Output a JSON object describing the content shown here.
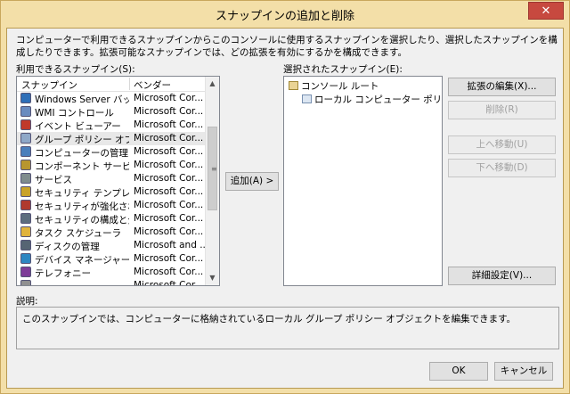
{
  "window": {
    "title": "スナップインの追加と削除",
    "close_glyph": "✕"
  },
  "intro_text": "コンピューターで利用できるスナップインからこのコンソールに使用するスナップインを選択したり、選択したスナップインを構成したりできます。拡張可能なスナップインでは、どの拡張を有効にするかを構成できます。",
  "available": {
    "label": "利用できるスナップイン(S):",
    "col_snapin": "スナップイン",
    "col_vendor": "ベンダー",
    "rows": [
      {
        "name": "Windows Server バッ...",
        "vendor": "Microsoft Cor...",
        "icon": "server-backup-icon",
        "color": "#2f6fb8"
      },
      {
        "name": "WMI コントロール",
        "vendor": "Microsoft Cor...",
        "icon": "wmi-icon",
        "color": "#6a8bbf"
      },
      {
        "name": "イベント ビューアー",
        "vendor": "Microsoft Cor...",
        "icon": "event-viewer-icon",
        "color": "#c0392b"
      },
      {
        "name": "グループ ポリシー オブジェ...",
        "vendor": "Microsoft Cor...",
        "icon": "group-policy-icon",
        "color": "#8fa8c8"
      },
      {
        "name": "コンピューターの管理",
        "vendor": "Microsoft Cor...",
        "icon": "computer-management-icon",
        "color": "#4a7ebb"
      },
      {
        "name": "コンポーネント サービス",
        "vendor": "Microsoft Cor...",
        "icon": "component-services-icon",
        "color": "#b8962e"
      },
      {
        "name": "サービス",
        "vendor": "Microsoft Cor...",
        "icon": "services-icon",
        "color": "#7f8c8d"
      },
      {
        "name": "セキュリティ テンプレート",
        "vendor": "Microsoft Cor...",
        "icon": "security-template-icon",
        "color": "#c9a227"
      },
      {
        "name": "セキュリティが強化された ...",
        "vendor": "Microsoft Cor...",
        "icon": "firewall-icon",
        "color": "#b03a2e"
      },
      {
        "name": "セキュリティの構成と分析",
        "vendor": "Microsoft Cor...",
        "icon": "security-config-icon",
        "color": "#5d6d7e"
      },
      {
        "name": "タスク スケジューラ",
        "vendor": "Microsoft Cor...",
        "icon": "task-scheduler-icon",
        "color": "#e0b33c"
      },
      {
        "name": "ディスクの管理",
        "vendor": "Microsoft and ...",
        "icon": "disk-management-icon",
        "color": "#566573"
      },
      {
        "name": "デバイス マネージャー",
        "vendor": "Microsoft Cor...",
        "icon": "device-manager-icon",
        "color": "#2e86c1"
      },
      {
        "name": "テレフォニー",
        "vendor": "Microsoft Cor...",
        "icon": "telephony-icon",
        "color": "#7d3c98"
      },
      {
        "name": "...",
        "vendor": "Microsoft Cor...",
        "icon": "snapin-icon",
        "color": "#909090"
      }
    ],
    "selected_index": 3
  },
  "add_button": "追加(A) >",
  "selected": {
    "label": "選択されたスナップイン(E):",
    "root": "コンソール ルート",
    "child": "ローカル コンピューター ポリシー"
  },
  "side_buttons": {
    "edit_extensions": "拡張の編集(X)...",
    "remove": "削除(R)",
    "move_up": "上へ移動(U)",
    "move_down": "下へ移動(D)",
    "advanced": "詳細設定(V)..."
  },
  "description": {
    "label": "説明:",
    "text": "このスナップインでは、コンピューターに格納されているローカル グループ ポリシー オブジェクトを編集できます。"
  },
  "footer": {
    "ok": "OK",
    "cancel": "キャンセル"
  }
}
